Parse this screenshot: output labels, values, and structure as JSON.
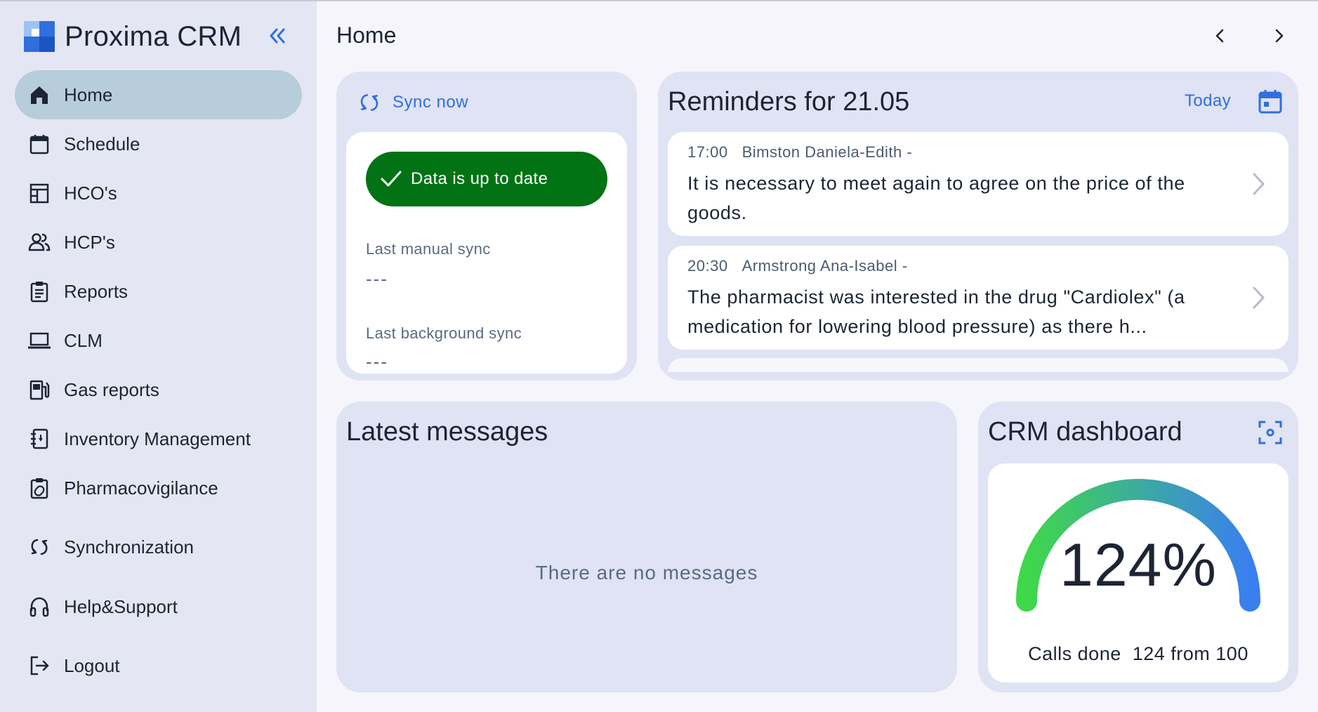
{
  "app": {
    "name": "Proxima CRM"
  },
  "sidebar": {
    "items": [
      {
        "label": "Home",
        "icon": "home-icon",
        "active": true
      },
      {
        "label": "Schedule",
        "icon": "calendar-icon"
      },
      {
        "label": "HCO's",
        "icon": "building-icon"
      },
      {
        "label": "HCP's",
        "icon": "users-icon"
      },
      {
        "label": "Reports",
        "icon": "clipboard-icon"
      },
      {
        "label": "CLM",
        "icon": "laptop-icon"
      },
      {
        "label": "Gas reports",
        "icon": "gas-station-icon"
      },
      {
        "label": "Inventory Management",
        "icon": "notebook-icon"
      },
      {
        "label": "Pharmacovigilance",
        "icon": "clipboard-pill-icon"
      },
      {
        "label": "Synchronization",
        "icon": "sync-icon"
      },
      {
        "label": "Help&Support",
        "icon": "headset-icon"
      },
      {
        "label": "Logout",
        "icon": "logout-icon"
      }
    ]
  },
  "header": {
    "title": "Home"
  },
  "sync": {
    "button_label": "Sync now",
    "status": "Data is up to date",
    "manual_label": "Last manual sync",
    "manual_value": "---",
    "background_label": "Last background sync",
    "background_value": "---"
  },
  "reminders": {
    "title": "Reminders for 21.05",
    "today_label": "Today",
    "items": [
      {
        "time": "17:00",
        "person": "Bimston Daniela-Edith -",
        "text": "It is necessary to meet again to agree on the price of the goods."
      },
      {
        "time": "20:30",
        "person": "Armstrong Ana-Isabel -",
        "text": "The pharmacist was interested in the drug \"Cardiolex\" (a medication for lowering blood pressure) as there h..."
      }
    ]
  },
  "messages": {
    "title": "Latest messages",
    "empty_text": "There are no messages"
  },
  "crm": {
    "title": "CRM dashboard",
    "gauge_value": "124%",
    "gauge_fraction": 1.0,
    "calls_label": "Calls done",
    "calls_value": "124 from 100"
  },
  "colors": {
    "accent": "#2f6fe0",
    "sidebar_bg": "#e4e7f3",
    "active_item": "#b8cddc",
    "card_bg": "#dfe3f3",
    "status_green": "#027314",
    "gauge_start": "#3fd84a",
    "gauge_end": "#3a7ff0"
  }
}
